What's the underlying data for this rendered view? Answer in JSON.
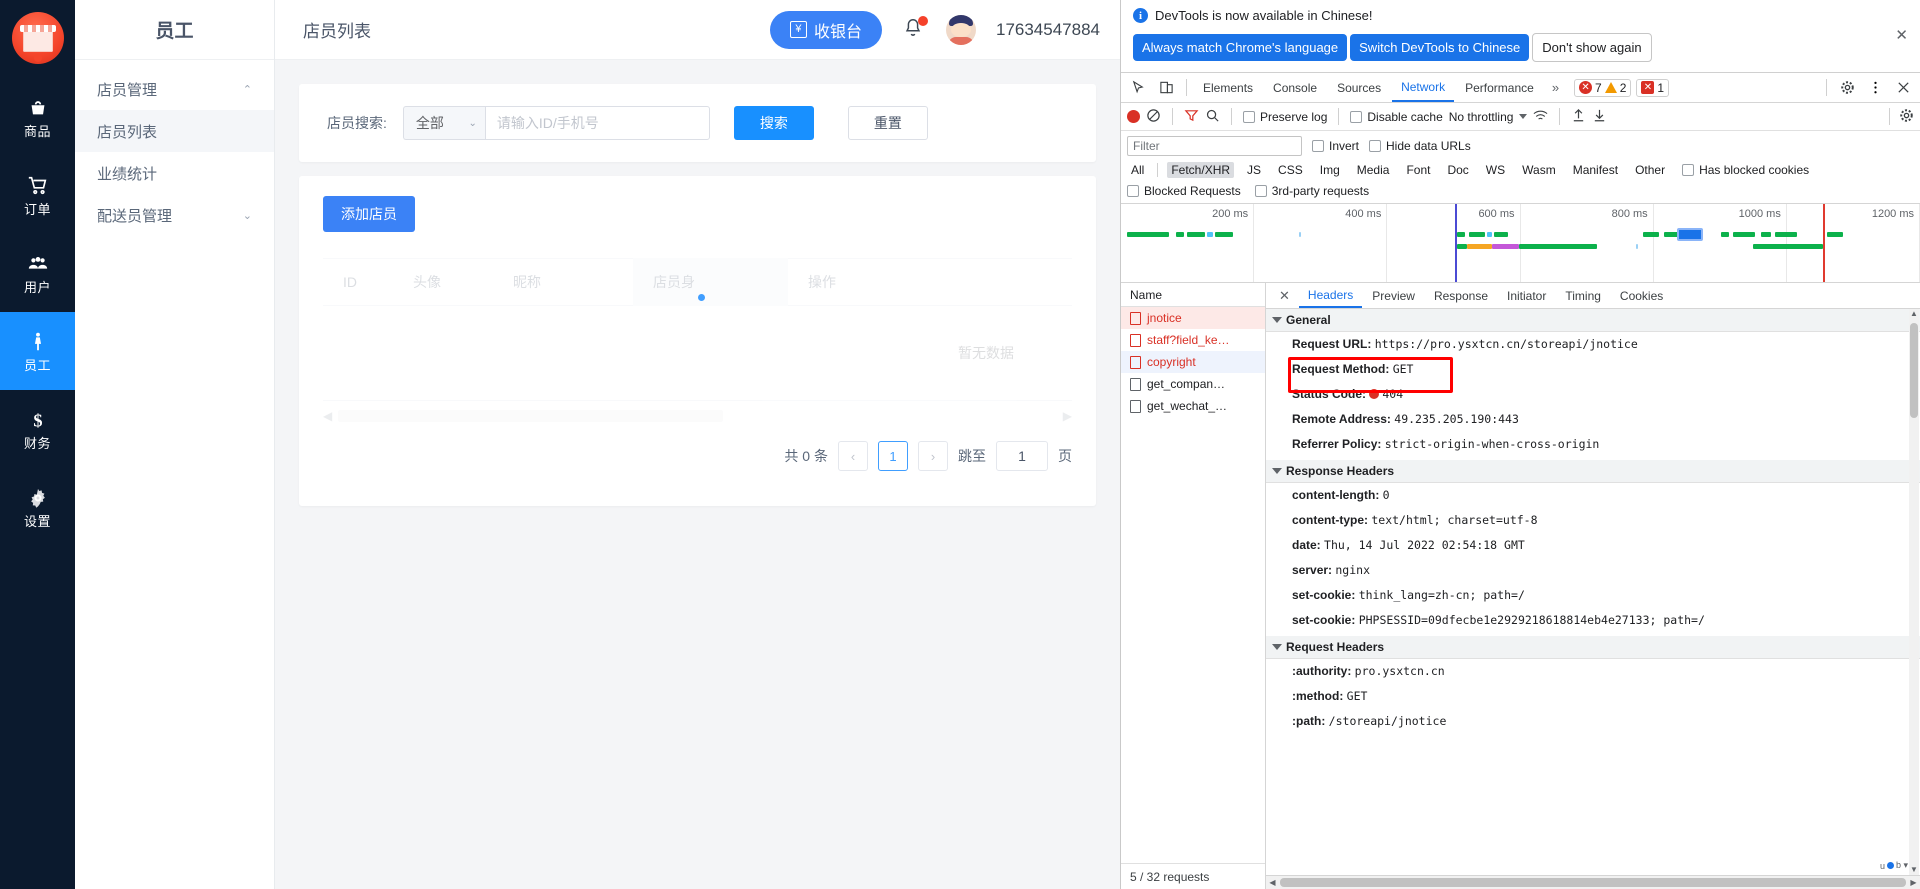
{
  "rail": {
    "logo_name": "app-logo",
    "items": [
      {
        "label": "商品",
        "icon": "basket-icon",
        "active": false
      },
      {
        "label": "订单",
        "icon": "cart-icon",
        "active": false
      },
      {
        "label": "用户",
        "icon": "users-icon",
        "active": false
      },
      {
        "label": "员工",
        "icon": "person-icon",
        "active": true
      },
      {
        "label": "财务",
        "icon": "dollar-icon",
        "active": false
      },
      {
        "label": "设置",
        "icon": "gear-icon",
        "active": false
      }
    ]
  },
  "subnav": {
    "title": "员工",
    "items": [
      {
        "label": "店员管理",
        "caret": "⌃",
        "selected": false,
        "child": false
      },
      {
        "label": "店员列表",
        "caret": "",
        "selected": true,
        "child": true
      },
      {
        "label": "业绩统计",
        "caret": "",
        "selected": false,
        "child": true
      },
      {
        "label": "配送员管理",
        "caret": "⌄",
        "selected": false,
        "child": false
      }
    ]
  },
  "topbar": {
    "breadcrumb": "店员列表",
    "cashier_label": "收银台",
    "cashier_icon": "¥",
    "phone": "17634547884"
  },
  "search": {
    "label": "店员搜索:",
    "select_value": "全部",
    "input_value": "",
    "input_placeholder": "请输入ID/手机号",
    "search_btn": "搜索",
    "reset_btn": "重置"
  },
  "table": {
    "add_btn": "添加店员",
    "columns": [
      "ID",
      "头像",
      "昵称",
      "店员身",
      "操作"
    ],
    "empty_text": "暂无数据"
  },
  "pager": {
    "total_text": "共 0 条",
    "prev": "‹",
    "page": "1",
    "next": "›",
    "jump_label": "跳至",
    "jump_value": "1",
    "page_unit": "页"
  },
  "devtools": {
    "banner": {
      "message": "DevTools is now available in Chinese!",
      "btn_always": "Always match Chrome's language",
      "btn_switch": "Switch DevTools to Chinese",
      "btn_dismiss": "Don't show again",
      "close": "✕"
    },
    "tabs": [
      "Elements",
      "Console",
      "Sources",
      "Network",
      "Performance"
    ],
    "active_tab": "Network",
    "more_tabs": "»",
    "counts": {
      "errors": "7",
      "warnings": "2",
      "issues": "1"
    },
    "toolbar": {
      "preserve_log": "Preserve log",
      "disable_cache": "Disable cache",
      "throttling": "No throttling"
    },
    "filter": {
      "placeholder": "Filter",
      "value": "",
      "invert": "Invert",
      "hide_data_urls": "Hide data URLs",
      "types": [
        "All",
        "Fetch/XHR",
        "JS",
        "CSS",
        "Img",
        "Media",
        "Font",
        "Doc",
        "WS",
        "Wasm",
        "Manifest",
        "Other"
      ],
      "active_type": "Fetch/XHR",
      "has_blocked_cookies": "Has blocked cookies",
      "blocked_requests": "Blocked Requests",
      "third_party": "3rd-party requests"
    },
    "overview_ticks": [
      "200 ms",
      "400 ms",
      "600 ms",
      "800 ms",
      "1000 ms",
      "1200 ms"
    ],
    "requests": {
      "header": "Name",
      "rows": [
        {
          "name": "jnotice",
          "state": "selected-error"
        },
        {
          "name": "staff?field_ke…",
          "state": "error"
        },
        {
          "name": "copyright",
          "state": "error-alt"
        },
        {
          "name": "get_compan…",
          "state": "normal"
        },
        {
          "name": "get_wechat_…",
          "state": "normal"
        }
      ],
      "footer": "5 / 32 requests"
    },
    "detail_tabs": [
      "Headers",
      "Preview",
      "Response",
      "Initiator",
      "Timing",
      "Cookies"
    ],
    "detail_active": "Headers",
    "sections": [
      {
        "title": "General",
        "rows": [
          {
            "key": "Request URL:",
            "value": "https://pro.ysxtcn.cn/storeapi/jnotice"
          },
          {
            "key": "Request Method:",
            "value": "GET"
          },
          {
            "key": "Status Code:",
            "value": "404",
            "status": true
          },
          {
            "key": "Remote Address:",
            "value": "49.235.205.190:443"
          },
          {
            "key": "Referrer Policy:",
            "value": "strict-origin-when-cross-origin"
          }
        ]
      },
      {
        "title": "Response Headers",
        "rows": [
          {
            "key": "content-length:",
            "value": "0"
          },
          {
            "key": "content-type:",
            "value": "text/html; charset=utf-8"
          },
          {
            "key": "date:",
            "value": "Thu, 14 Jul 2022 02:54:18 GMT"
          },
          {
            "key": "server:",
            "value": "nginx"
          },
          {
            "key": "set-cookie:",
            "value": "think_lang=zh-cn; path=/"
          },
          {
            "key": "set-cookie:",
            "value": "PHPSESSID=09dfecbe1e2929218618814eb4e27133; path=/"
          }
        ]
      },
      {
        "title": "Request Headers",
        "rows": [
          {
            "key": ":authority:",
            "value": "pro.ysxtcn.cn"
          },
          {
            "key": ":method:",
            "value": "GET"
          },
          {
            "key": ":path:",
            "value": "/storeapi/jnotice"
          }
        ]
      }
    ]
  },
  "colors": {
    "brand_blue": "#1890ff",
    "rail_dark": "#0b1a2e",
    "devtools_blue": "#1a73e8",
    "error_red": "#d93025",
    "highlight_red": "#ff0000"
  }
}
